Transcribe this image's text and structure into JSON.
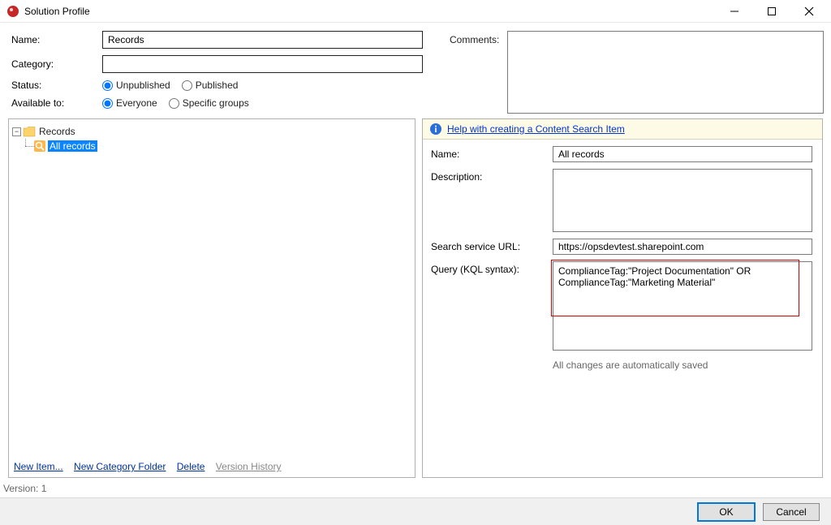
{
  "window": {
    "title": "Solution Profile"
  },
  "top": {
    "name_label": "Name:",
    "name_value": "Records",
    "category_label": "Category:",
    "category_value": "",
    "status_label": "Status:",
    "status_unpublished": "Unpublished",
    "status_published": "Published",
    "status_selected": "Unpublished",
    "available_label": "Available to:",
    "available_everyone": "Everyone",
    "available_specific": "Specific groups",
    "available_selected": "Everyone",
    "comments_label": "Comments:",
    "comments_value": ""
  },
  "tree": {
    "root_label": "Records",
    "child_label": "All records"
  },
  "tree_links": {
    "new_item": "New Item...",
    "new_category": "New Category Folder",
    "delete": "Delete",
    "version_history": "Version History"
  },
  "detail": {
    "help_link": "Help with creating a Content Search Item",
    "name_label": "Name:",
    "name_value": "All records",
    "description_label": "Description:",
    "description_value": "",
    "url_label": "Search service URL:",
    "url_value": "https://opsdevtest.sharepoint.com",
    "query_label": "Query (KQL syntax):",
    "query_value": "ComplianceTag:\"Project Documentation\" OR ComplianceTag:\"Marketing Material\"",
    "save_note": "All changes are automatically saved"
  },
  "footer": {
    "version_text": "Version: 1",
    "ok_label": "OK",
    "cancel_label": "Cancel"
  }
}
